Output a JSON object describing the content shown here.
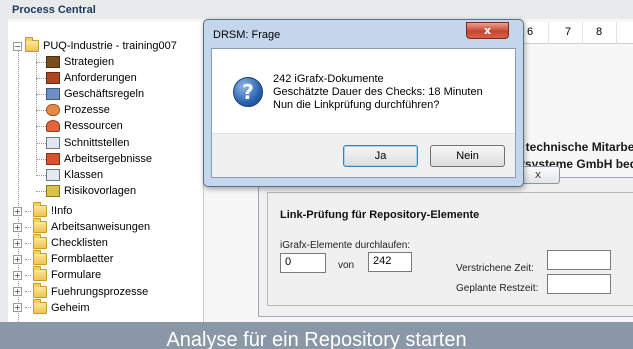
{
  "tree": {
    "title": "Process Central",
    "root_label": "PUQ-Industrie - training007",
    "items": [
      {
        "label": "Strategien",
        "icon": "strategy-icon"
      },
      {
        "label": "Anforderungen",
        "icon": "requirements-icon"
      },
      {
        "label": "Geschäftsregeln",
        "icon": "business-rules-icon"
      },
      {
        "label": "Prozesse",
        "icon": "process-icon"
      },
      {
        "label": "Ressourcen",
        "icon": "resources-icon"
      },
      {
        "label": "Schnittstellen",
        "icon": "interfaces-icon"
      },
      {
        "label": "Arbeitsergebnisse",
        "icon": "work-results-icon"
      },
      {
        "label": "Klassen",
        "icon": "classes-icon"
      },
      {
        "label": "Risikovorlagen",
        "icon": "risk-templates-icon"
      }
    ],
    "folders": [
      {
        "label": "!Info"
      },
      {
        "label": "Arbeitsanweisungen"
      },
      {
        "label": "Checklisten"
      },
      {
        "label": "Formblaetter"
      },
      {
        "label": "Formulare"
      },
      {
        "label": "Fuehrungsprozesse"
      },
      {
        "label": "Geheim"
      }
    ],
    "expander_collapsed": "+",
    "expander_expanded": "−"
  },
  "background": {
    "columns": [
      "6",
      "7",
      "8"
    ],
    "text_line1": "h technische Mitarbe",
    "text_line2": "tsysteme GmbH bedi"
  },
  "link_check": {
    "close_label": "ⅹ",
    "title": "Link-Prüfung für Repository-Elemente",
    "elements_label": "iGrafx-Elemente durchlaufen:",
    "current_value": "0",
    "of_label": "von",
    "total_value": "242",
    "elapsed_label": "Verstrichene Zeit:",
    "remaining_label": "Geplante Restzeit:",
    "elapsed_value": "",
    "remaining_value": ""
  },
  "dialog": {
    "title": "DRSM: Frage",
    "close_label": "x",
    "icon": "question-icon",
    "message_line1": "242 iGrafx-Dokumente",
    "message_line2": "Geschätzte Dauer des Checks: 18 Minuten",
    "message_line3": "Nun die Linkprüfung durchführen?",
    "yes_label": "Ja",
    "no_label": "Nein"
  },
  "caption": {
    "text": "Analyse für ein Repository starten"
  },
  "colors": {
    "dialog_frame": "#c4d6ec",
    "close_button": "#c8452e",
    "caption_bar": "#8a97a6"
  }
}
